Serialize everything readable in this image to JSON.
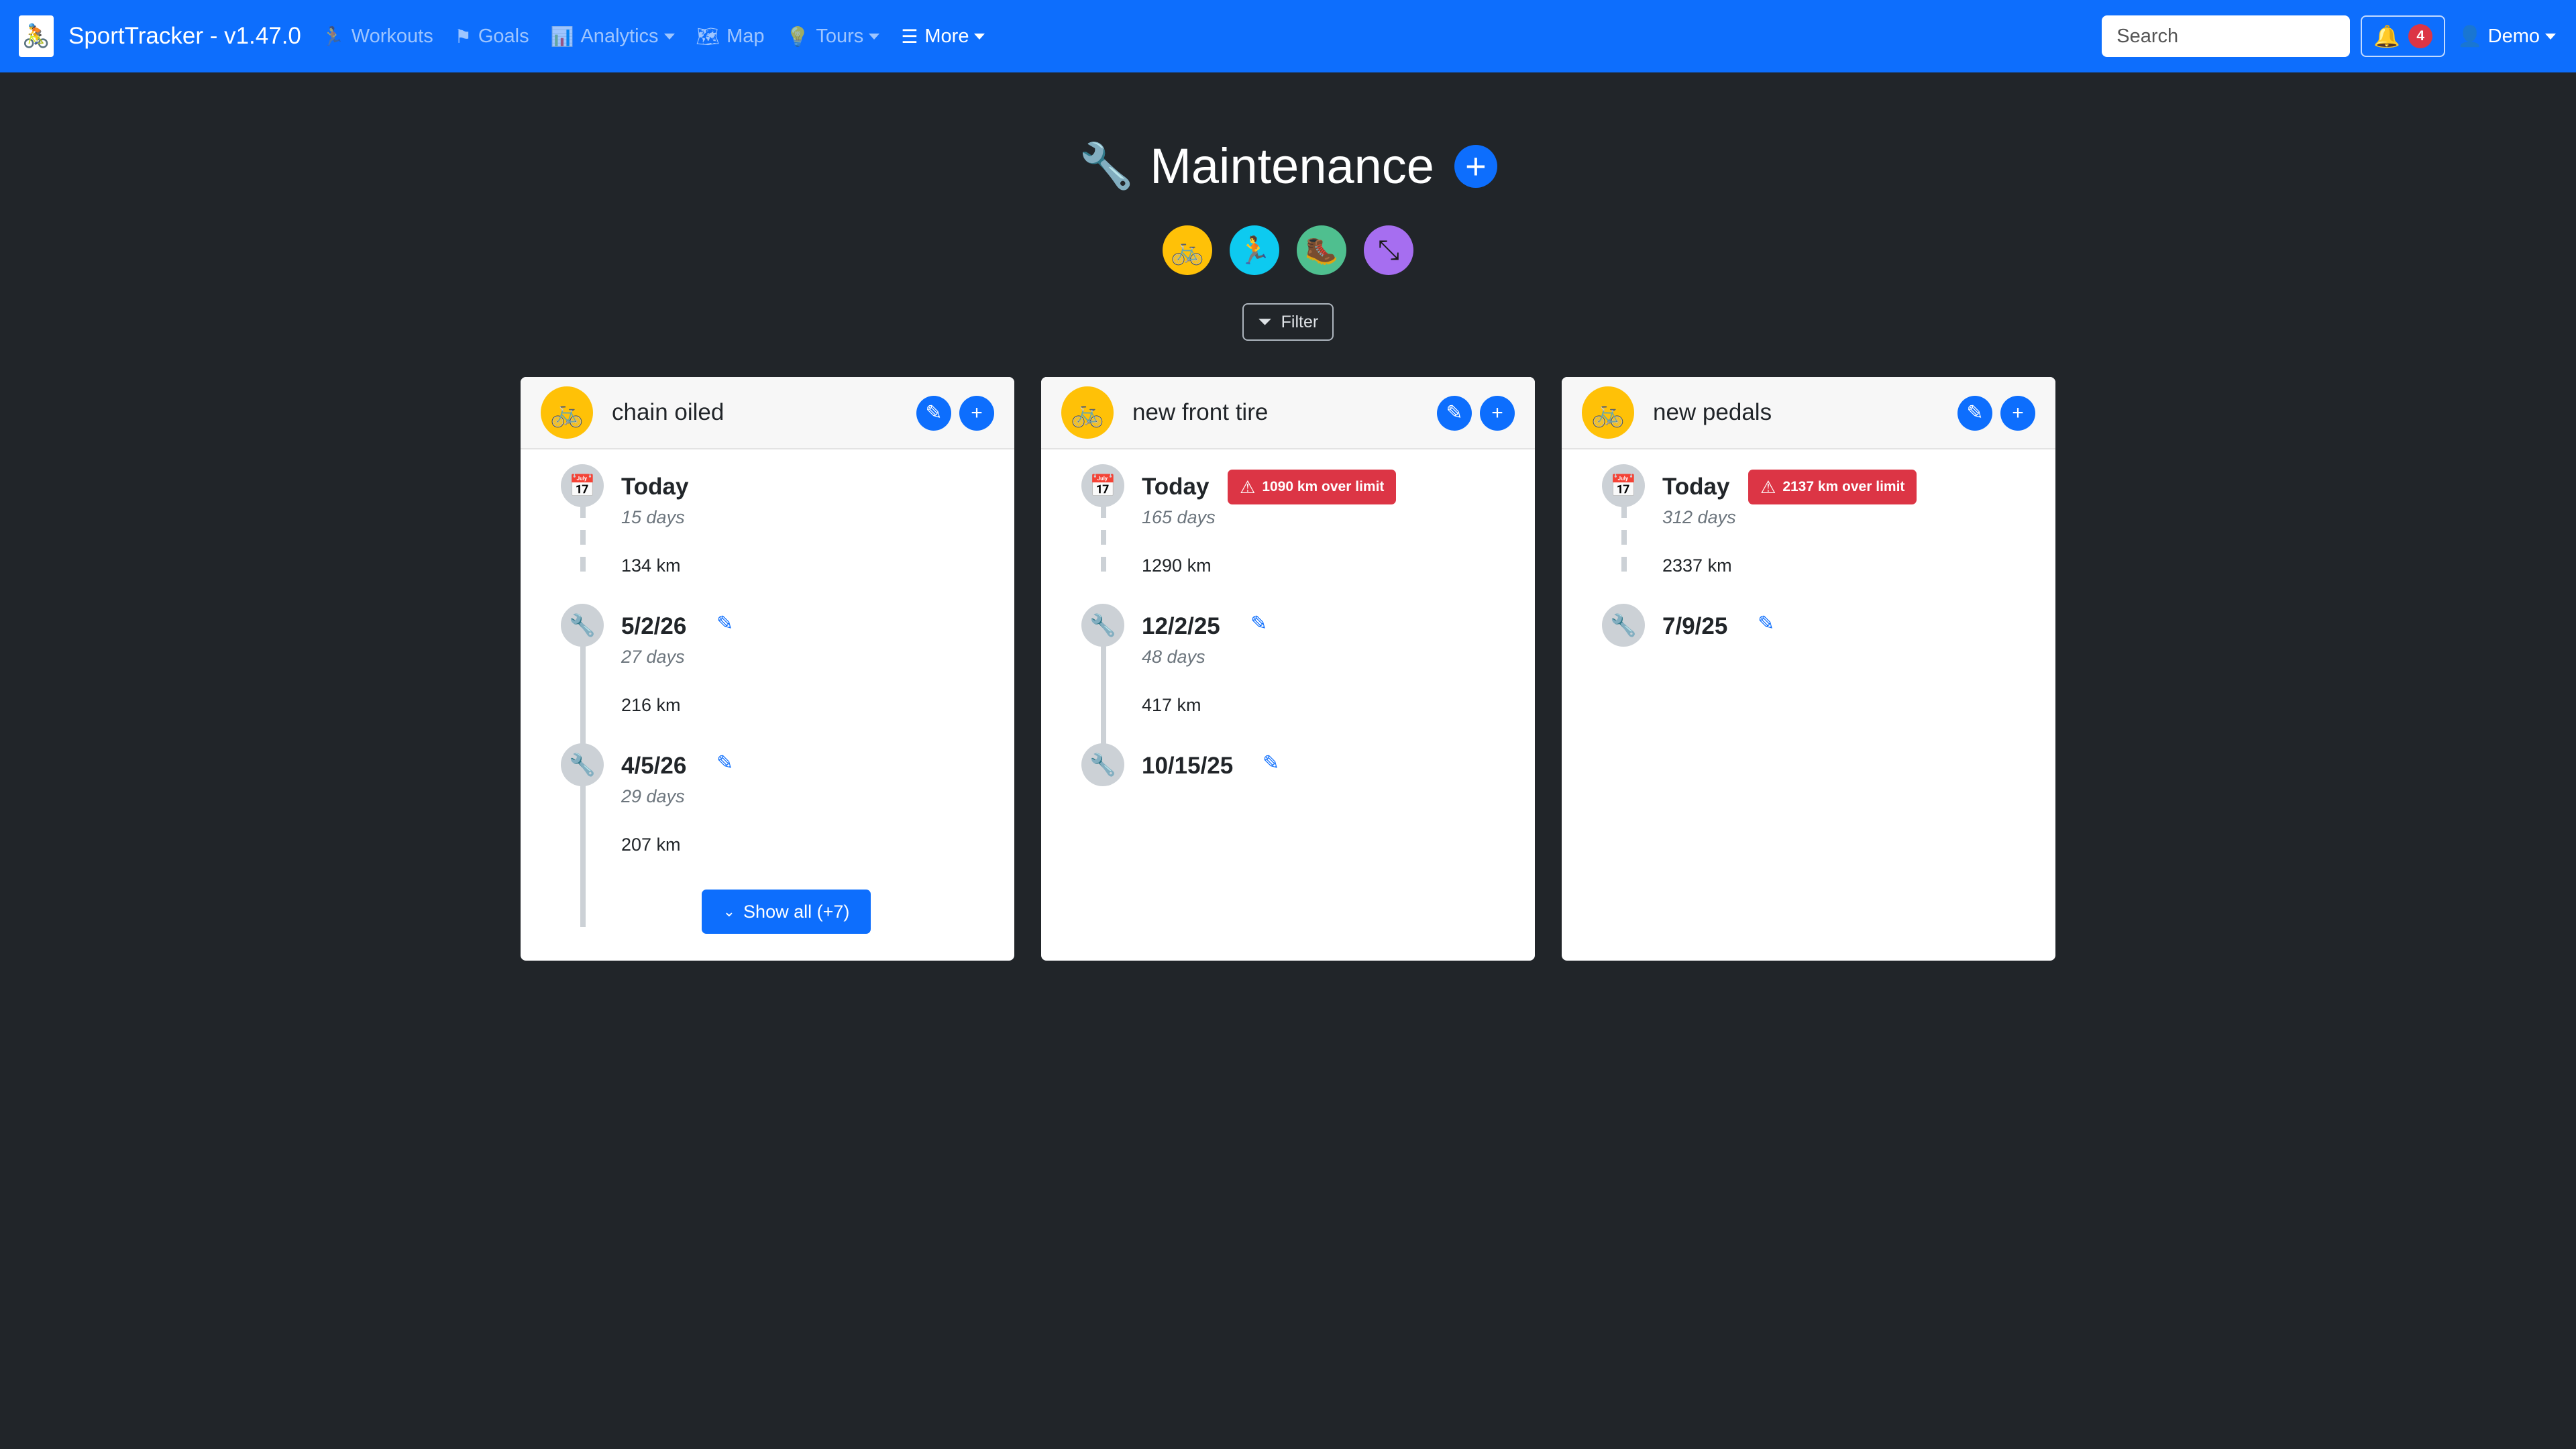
{
  "navbar": {
    "brand": "SportTracker - v1.47.0",
    "items": [
      {
        "label": "Workouts",
        "icon": "running-icon"
      },
      {
        "label": "Goals",
        "icon": "flag-icon"
      },
      {
        "label": "Analytics",
        "icon": "bar-chart-icon"
      },
      {
        "label": "Map",
        "icon": "map-icon"
      },
      {
        "label": "Tours",
        "icon": "lightbulb-icon"
      },
      {
        "label": "More",
        "icon": "list-icon"
      }
    ],
    "search_placeholder": "Search",
    "notifications_count": "4",
    "user": "Demo"
  },
  "page": {
    "title": "Maintenance",
    "filter_label": "Filter",
    "sport_filters": [
      {
        "icon": "bike-icon",
        "color": "#ffc107"
      },
      {
        "icon": "running-icon",
        "color": "#0dcaf0"
      },
      {
        "icon": "hiking-icon",
        "color": "#4fbf8f"
      },
      {
        "icon": "dumbbell-icon",
        "color": "#a66ef0"
      }
    ]
  },
  "cards": [
    {
      "title": "chain oiled",
      "entries": [
        {
          "date": "Today",
          "days": "15 days",
          "km": "134 km"
        },
        {
          "date": "5/2/26",
          "days": "27 days",
          "km": "216 km"
        },
        {
          "date": "4/5/26",
          "days": "29 days",
          "km": "207 km"
        }
      ],
      "show_all": "Show all (+7)"
    },
    {
      "title": "new front tire",
      "warning": "1090 km over limit",
      "entries": [
        {
          "date": "Today",
          "days": "165 days",
          "km": "1290 km"
        },
        {
          "date": "12/2/25",
          "days": "48 days",
          "km": "417 km"
        },
        {
          "date": "10/15/25"
        }
      ]
    },
    {
      "title": "new pedals",
      "warning": "2137 km over limit",
      "entries": [
        {
          "date": "Today",
          "days": "312 days",
          "km": "2337 km"
        },
        {
          "date": "7/9/25"
        }
      ]
    }
  ],
  "colors": {
    "primary": "#0d6efd",
    "danger": "#dc3545",
    "background": "#212529",
    "bike_accent": "#ffc107"
  }
}
